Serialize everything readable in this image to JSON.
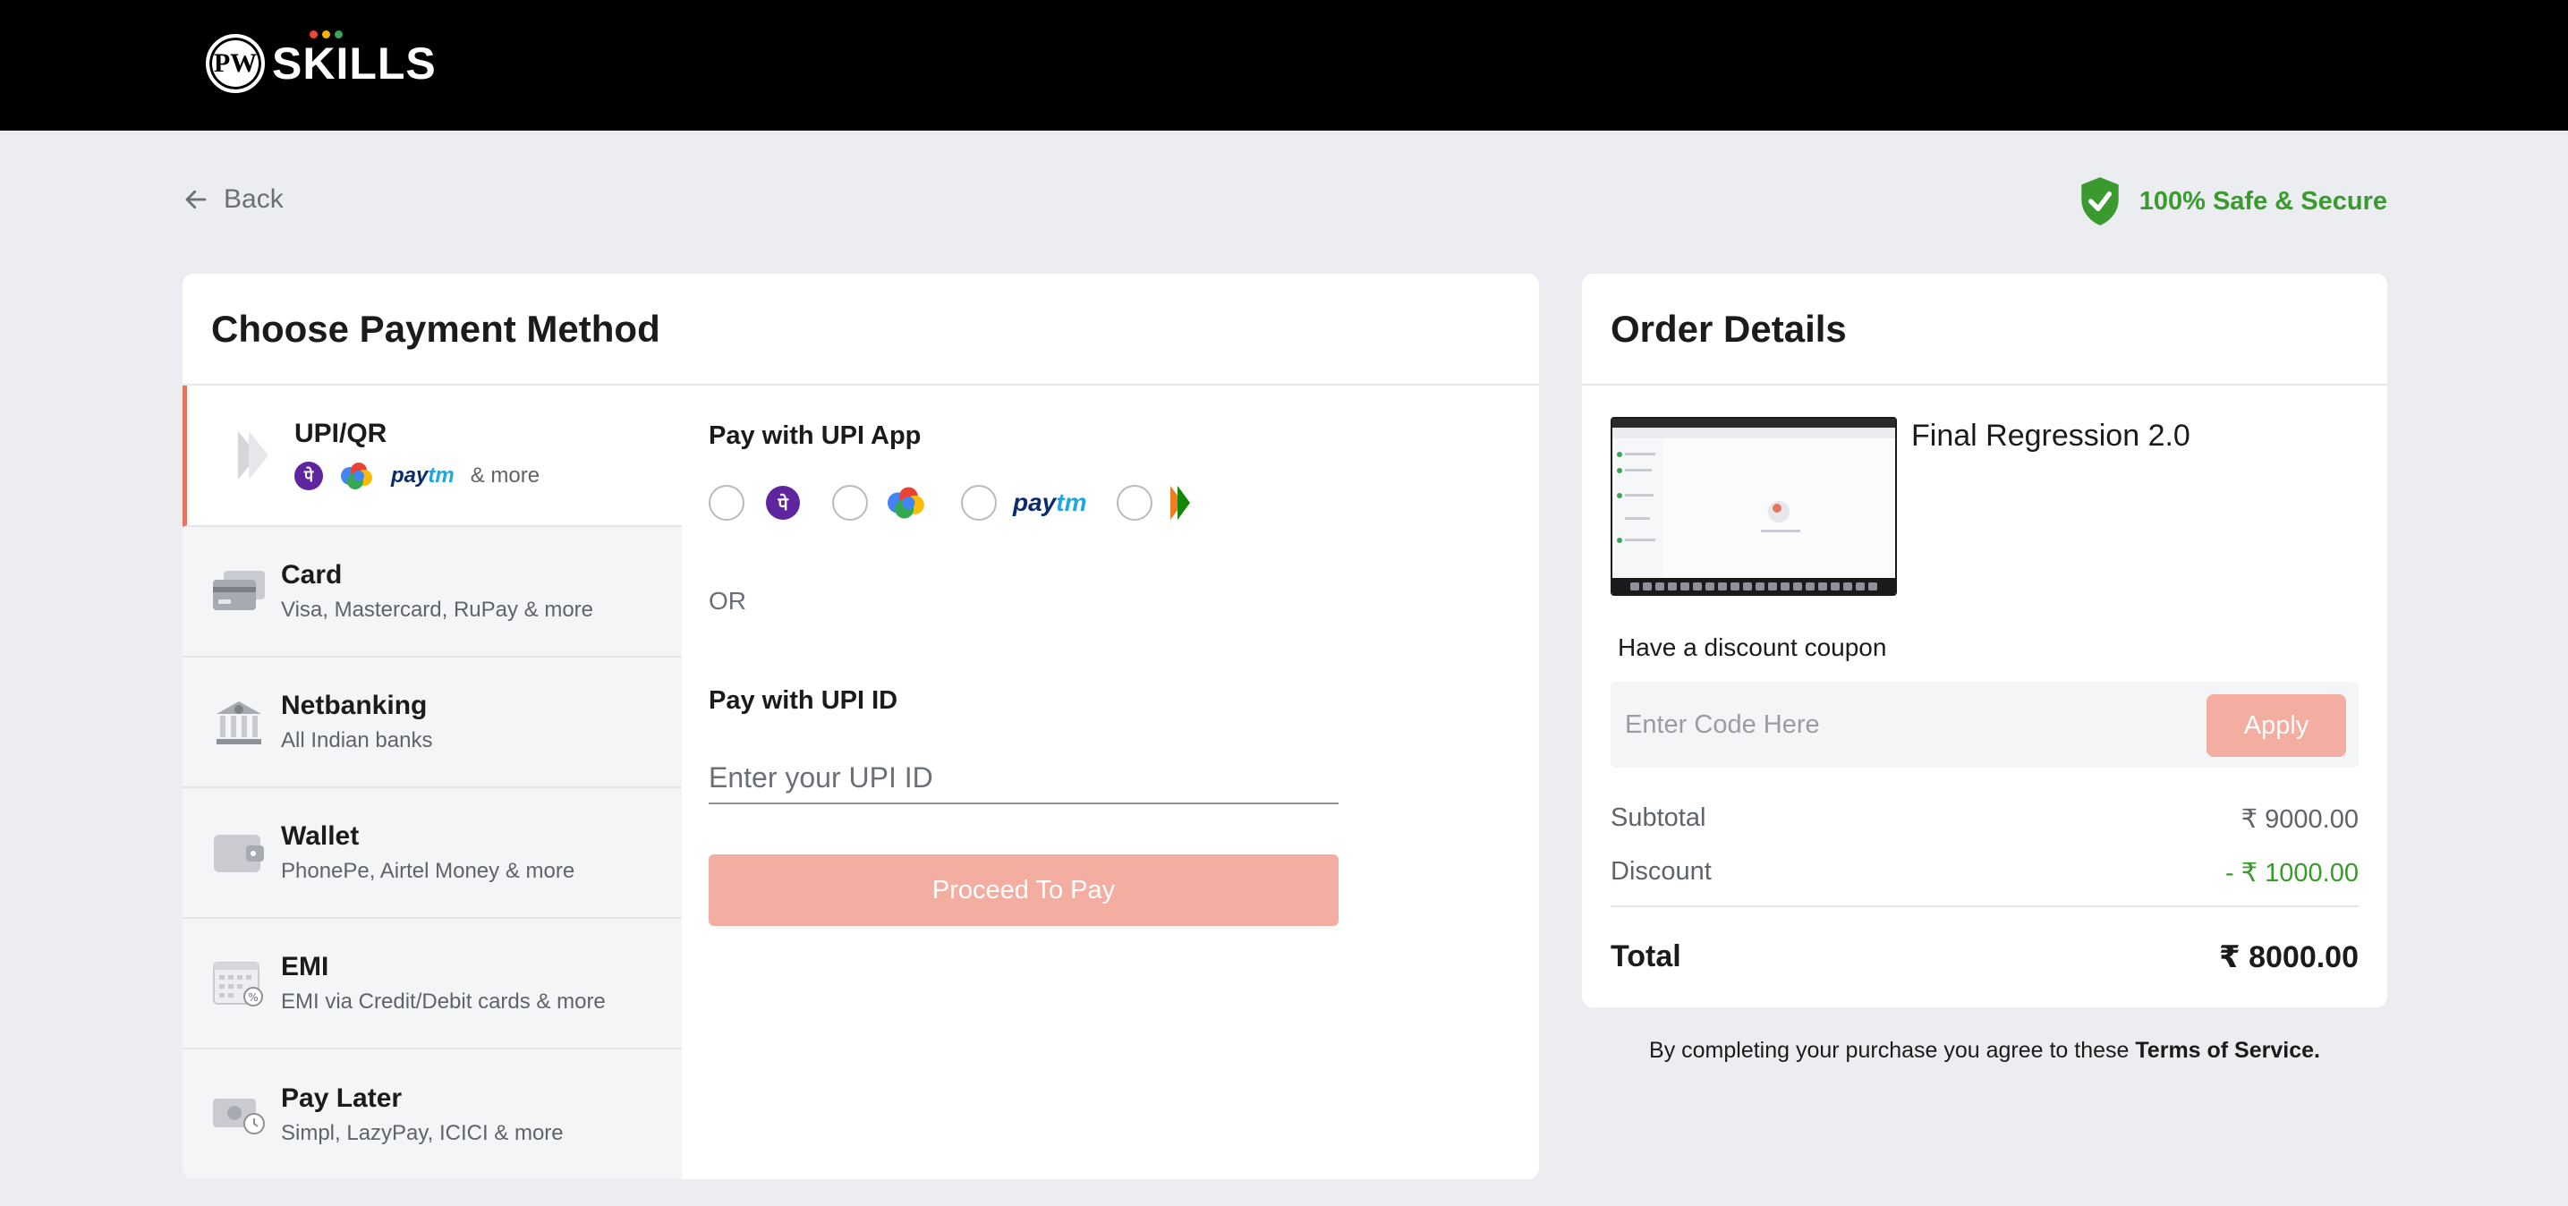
{
  "header": {
    "logo_mark": "PW",
    "logo_text": "SKILLS"
  },
  "nav": {
    "back_label": "Back",
    "secure_label": "100% Safe & Secure"
  },
  "payment": {
    "title": "Choose Payment Method",
    "methods": [
      {
        "id": "upi",
        "title": "UPI/QR",
        "subtitle": "& more",
        "icon": "upi-icon"
      },
      {
        "id": "card",
        "title": "Card",
        "subtitle": "Visa, Mastercard, RuPay & more",
        "icon": "card-icon"
      },
      {
        "id": "netbanking",
        "title": "Netbanking",
        "subtitle": "All Indian banks",
        "icon": "bank-icon"
      },
      {
        "id": "wallet",
        "title": "Wallet",
        "subtitle": "PhonePe, Airtel Money & more",
        "icon": "wallet-icon"
      },
      {
        "id": "emi",
        "title": "EMI",
        "subtitle": "EMI via Credit/Debit cards & more",
        "icon": "calendar-icon"
      },
      {
        "id": "paylater",
        "title": "Pay Later",
        "subtitle": "Simpl, LazyPay, ICICI & more",
        "icon": "pay-later-icon"
      }
    ],
    "upi_apps": {
      "phonepe_glyph": "पे",
      "paytm_a": "pay",
      "paytm_b": "tm"
    },
    "pay_with_app_label": "Pay with UPI App",
    "or_label": "OR",
    "pay_with_id_label": "Pay with UPI ID",
    "upi_id_placeholder": "Enter your UPI ID",
    "upi_id_value": "",
    "proceed_label": "Proceed To Pay"
  },
  "order": {
    "title": "Order Details",
    "course_name": "Final Regression 2.0",
    "coupon_label": "Have a discount coupon",
    "coupon_placeholder": "Enter Code Here",
    "apply_label": "Apply",
    "subtotal_label": "Subtotal",
    "subtotal_value": "₹ 9000.00",
    "discount_label": "Discount",
    "discount_value": "- ₹ 1000.00",
    "total_label": "Total",
    "total_value": "₹ 8000.00"
  },
  "terms": {
    "text": "By completing your purchase you agree to these ",
    "link": "Terms of Service."
  },
  "colors": {
    "accent": "#f3ada1",
    "active_border": "#e8755f",
    "success": "#3a9a2e",
    "header_bg": "#000000"
  }
}
